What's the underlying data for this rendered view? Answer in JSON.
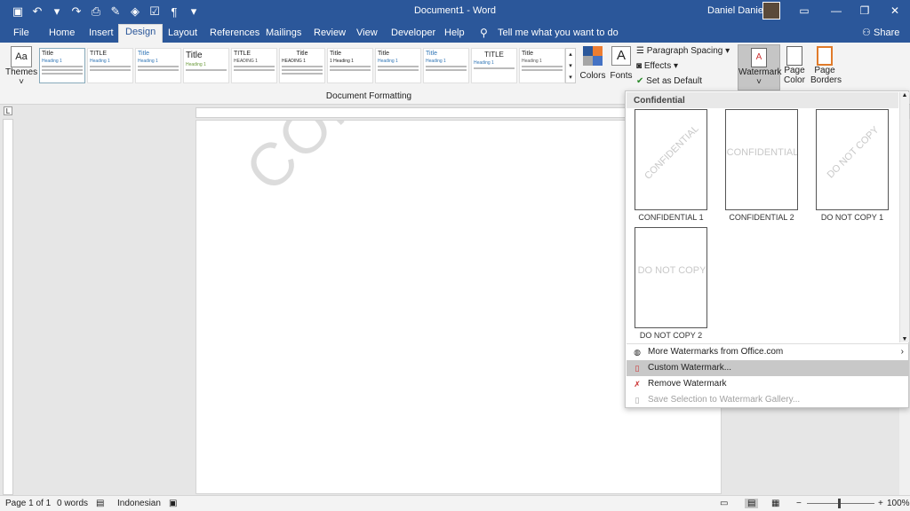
{
  "window": {
    "title": "Document1  -  Word",
    "user": "Daniel Daniel"
  },
  "qat": {
    "icons": [
      "save-icon",
      "undo-icon",
      "undo-dropdown-icon",
      "redo-icon",
      "print-preview-icon",
      "format-painter-icon",
      "highlight-icon",
      "checkbox-icon",
      "paragraph-marks-icon",
      "customize-icon"
    ]
  },
  "tabs": [
    "File",
    "Home",
    "Insert",
    "Design",
    "Layout",
    "References",
    "Mailings",
    "Review",
    "View",
    "Developer",
    "Help"
  ],
  "tell_me": "Tell me what you want to do",
  "share": "Share",
  "ribbon": {
    "themes": "Themes",
    "style_sets": [
      {
        "title": "Title",
        "heading": "Heading 1"
      },
      {
        "title": "TITLE",
        "heading": "Heading 1"
      },
      {
        "title": "Title",
        "heading": "Heading 1"
      },
      {
        "title": "Title",
        "heading": "Heading 1"
      },
      {
        "title": "TITLE",
        "heading": "HEADING 1"
      },
      {
        "title": "Title",
        "heading": "HEADING 1"
      },
      {
        "title": "Title",
        "heading": "1  Heading 1"
      },
      {
        "title": "Title",
        "heading": "Heading 1"
      },
      {
        "title": "Title",
        "heading": "Heading 1"
      },
      {
        "title": "TITLE",
        "heading": "Heading 1"
      },
      {
        "title": "Title",
        "heading": "Heading 1"
      }
    ],
    "colors": "Colors",
    "fonts": "Fonts",
    "paragraph_spacing": "Paragraph Spacing",
    "effects": "Effects",
    "set_default": "Set as Default",
    "watermark": "Watermark",
    "page_color": "Page Color",
    "page_borders": "Page Borders",
    "group_label": "Document Formatting"
  },
  "document": {
    "watermark_text": "CONFIDENTIAL"
  },
  "watermark_menu": {
    "header": "Confidential",
    "items": [
      {
        "preview": "CONFIDENTIAL",
        "caption": "CONFIDENTIAL 1"
      },
      {
        "preview": "CONFIDENTIAL",
        "caption": "CONFIDENTIAL 2"
      },
      {
        "preview": "DO NOT COPY",
        "caption": "DO NOT COPY 1"
      },
      {
        "preview": "DO NOT COPY",
        "caption": "DO NOT COPY 2"
      }
    ],
    "commands": [
      {
        "label": "More Watermarks from Office.com",
        "icon": "globe-icon"
      },
      {
        "label": "Custom Watermark...",
        "icon": "custom-watermark-icon"
      },
      {
        "label": "Remove Watermark",
        "icon": "remove-watermark-icon"
      },
      {
        "label": "Save Selection to Watermark Gallery...",
        "icon": "save-gallery-icon"
      }
    ]
  },
  "status": {
    "page": "Page 1 of 1",
    "words": "0 words",
    "language": "Indonesian",
    "zoom": "100%"
  },
  "colors": {
    "brand": "#2b579a",
    "ribbon": "#f3f3f3"
  }
}
